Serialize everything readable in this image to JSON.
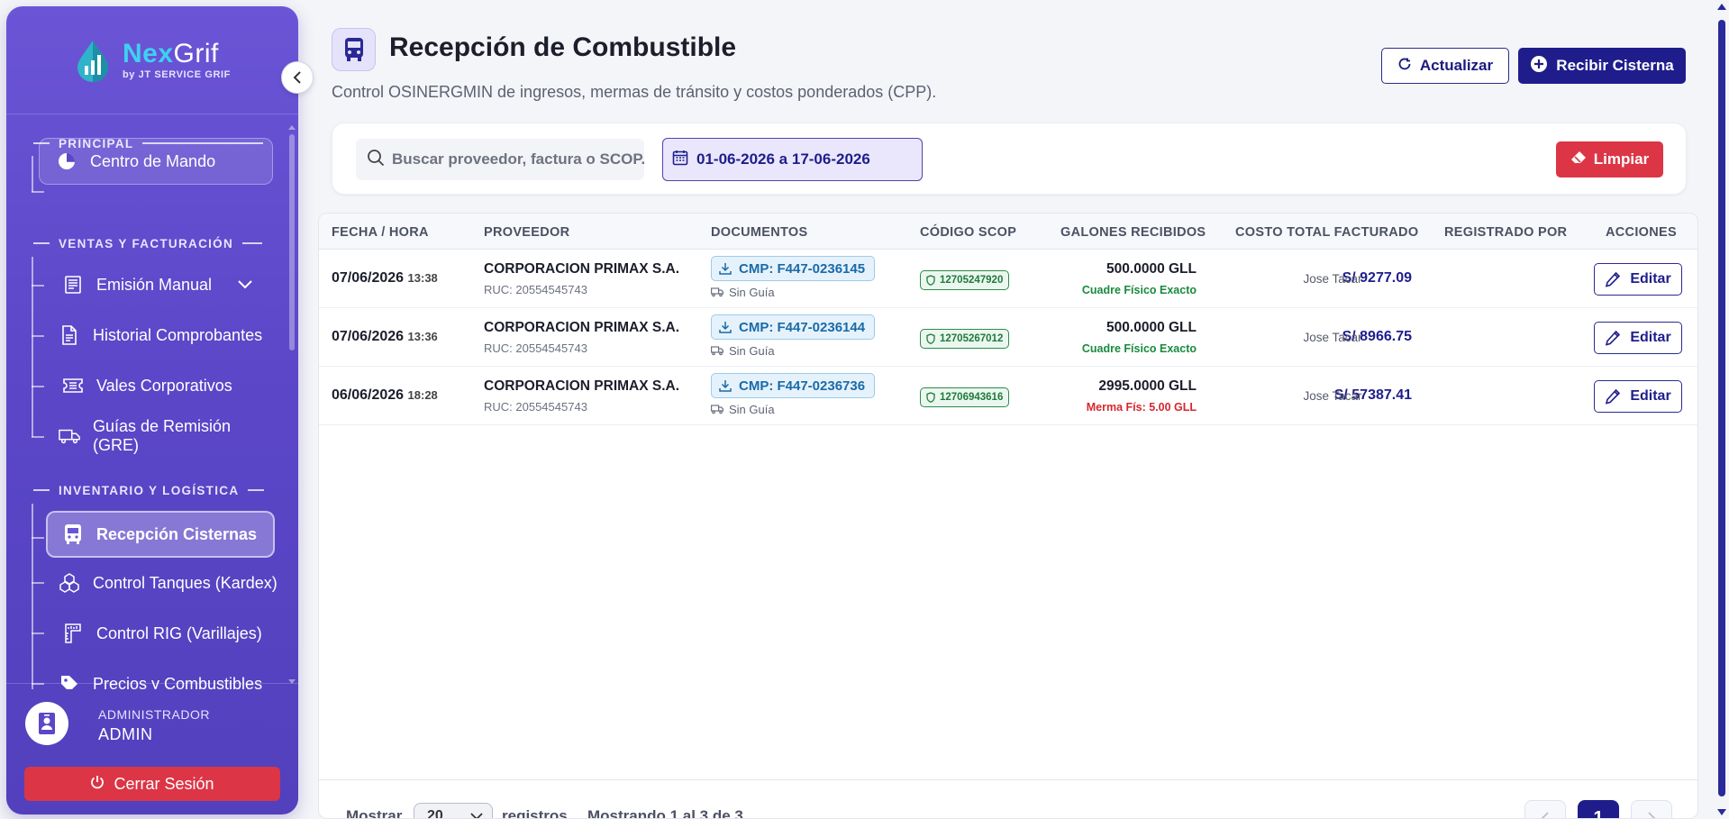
{
  "brand": {
    "name_part1": "Nex",
    "name_part2": "Grif",
    "subtitle": "by JT SERVICE GRIF"
  },
  "sidebar": {
    "sections": [
      {
        "title": "PRINCIPAL"
      },
      {
        "title": "VENTAS Y FACTURACIÓN"
      },
      {
        "title": "INVENTARIO Y LOGÍSTICA"
      }
    ],
    "items": [
      {
        "label": "Centro de Mando",
        "icon": "pie-chart-icon"
      },
      {
        "label": "Emisión Manual",
        "icon": "receipt-icon"
      },
      {
        "label": "Historial Comprobantes",
        "icon": "document-icon"
      },
      {
        "label": "Vales Corporativos",
        "icon": "ticket-icon"
      },
      {
        "label": "Guías de Remisión (GRE)",
        "icon": "truck-icon"
      },
      {
        "label": "Recepción Cisternas",
        "icon": "bus-icon"
      },
      {
        "label": "Control Tanques (Kardex)",
        "icon": "boxes-icon"
      },
      {
        "label": "Control RIG (Varillajes)",
        "icon": "ruler-icon"
      },
      {
        "label": "Precios y Combustibles",
        "icon": "tag-icon"
      }
    ],
    "user": {
      "role": "ADMINISTRADOR",
      "name": "ADMIN"
    },
    "logout_label": "Cerrar Sesión"
  },
  "header": {
    "title": "Recepción de Combustible",
    "subtitle": "Control OSINERGMIN de ingresos, mermas de tránsito y costos ponderados (CPP).",
    "refresh_label": "Actualizar",
    "receive_label": "Recibir Cisterna"
  },
  "filters": {
    "search_placeholder": "Buscar proveedor, factura o SCOP...",
    "date_range": "01-06-2026 a 17-06-2026",
    "clear_label": "Limpiar"
  },
  "table": {
    "columns": [
      "FECHA / HORA",
      "PROVEEDOR",
      "DOCUMENTOS",
      "CÓDIGO SCOP",
      "GALONES RECIBIDOS",
      "COSTO TOTAL FACTURADO",
      "REGISTRADO POR",
      "ACCIONES"
    ],
    "rows": [
      {
        "date": "07/06/2026",
        "time": "13:38",
        "provider": "CORPORACION PRIMAX S.A.",
        "ruc": "RUC: 20554545743",
        "doc": "CMP: F447-0236145",
        "guide": "Sin Guía",
        "scop": "12705247920",
        "gallons": "500.0000 GLL",
        "gallons_note": "Cuadre Físico Exacto",
        "note_status": "ok",
        "cost": "S/ 9277.09",
        "registered_by": "Jose Tacar",
        "edit_label": "Editar"
      },
      {
        "date": "07/06/2026",
        "time": "13:36",
        "provider": "CORPORACION PRIMAX S.A.",
        "ruc": "RUC: 20554545743",
        "doc": "CMP: F447-0236144",
        "guide": "Sin Guía",
        "scop": "12705267012",
        "gallons": "500.0000 GLL",
        "gallons_note": "Cuadre Físico Exacto",
        "note_status": "ok",
        "cost": "S/ 8966.75",
        "registered_by": "Jose Tacar",
        "edit_label": "Editar"
      },
      {
        "date": "06/06/2026",
        "time": "18:28",
        "provider": "CORPORACION PRIMAX S.A.",
        "ruc": "RUC: 20554545743",
        "doc": "CMP: F447-0236736",
        "guide": "Sin Guía",
        "scop": "12706943616",
        "gallons": "2995.0000 GLL",
        "gallons_note": "Merma Fís: 5.00 GLL",
        "note_status": "bad",
        "cost": "S/ 57387.41",
        "registered_by": "Jose Tacar",
        "edit_label": "Editar"
      }
    ],
    "footer": {
      "show_label": "Mostrar",
      "page_size": "20",
      "records_label": "registros",
      "showing_text": "Mostrando 1 al 3 de 3",
      "current_page": "1"
    }
  },
  "colors": {
    "primary": "#1f1d8c",
    "sidebar": "#5b47c8",
    "danger": "#dc3545",
    "accent": "#3ed0f3",
    "success": "#1a8a3d"
  }
}
